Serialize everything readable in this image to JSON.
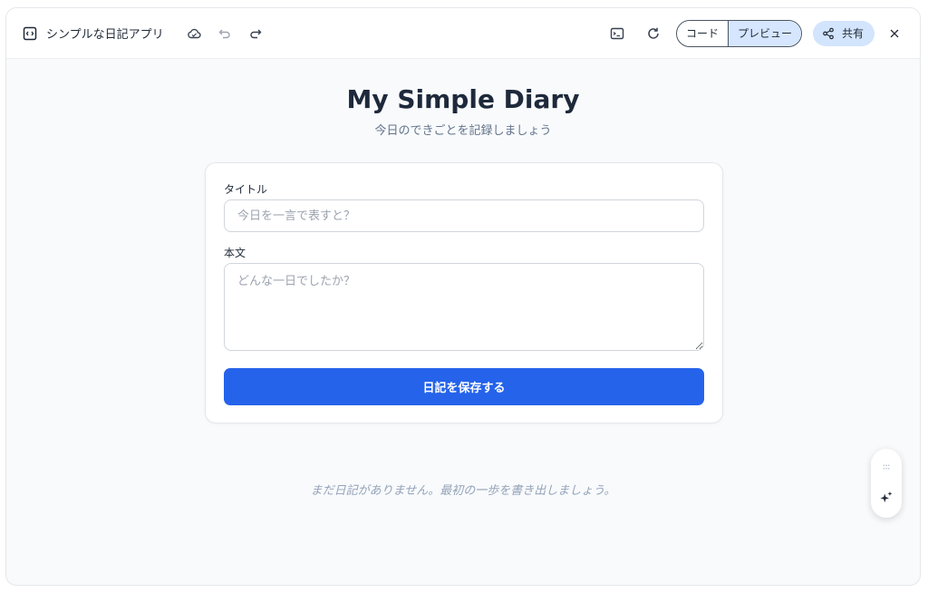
{
  "app": {
    "title": "シンプルな日記アプリ"
  },
  "toolbar": {
    "code_label": "コード",
    "preview_label": "プレビュー",
    "share_label": "共有",
    "active_view": "preview"
  },
  "page": {
    "title": "My Simple Diary",
    "subtitle": "今日のできごとを記録しましょう"
  },
  "form": {
    "title_label": "タイトル",
    "title_placeholder": "今日を一言で表すと？",
    "title_value": "",
    "body_label": "本文",
    "body_placeholder": "どんな一日でしたか？",
    "body_value": "",
    "save_label": "日記を保存する"
  },
  "entries": {
    "empty_message": "まだ日記がありません。最初の一歩を書き出しましょう。"
  },
  "colors": {
    "accent": "#2563eb",
    "share_bg": "#d3e4fd",
    "preview_active_bg": "#d6e6ff",
    "page_bg": "#f8fafc"
  },
  "icons": {
    "app": "code-window-icon",
    "cloud": "cloud-icon",
    "undo": "undo-icon",
    "redo": "redo-icon",
    "terminal": "terminal-icon",
    "refresh": "refresh-icon",
    "share": "share-icon",
    "close": "close-icon",
    "drag": "drag-handle-icon",
    "sparkle": "sparkle-icon"
  }
}
